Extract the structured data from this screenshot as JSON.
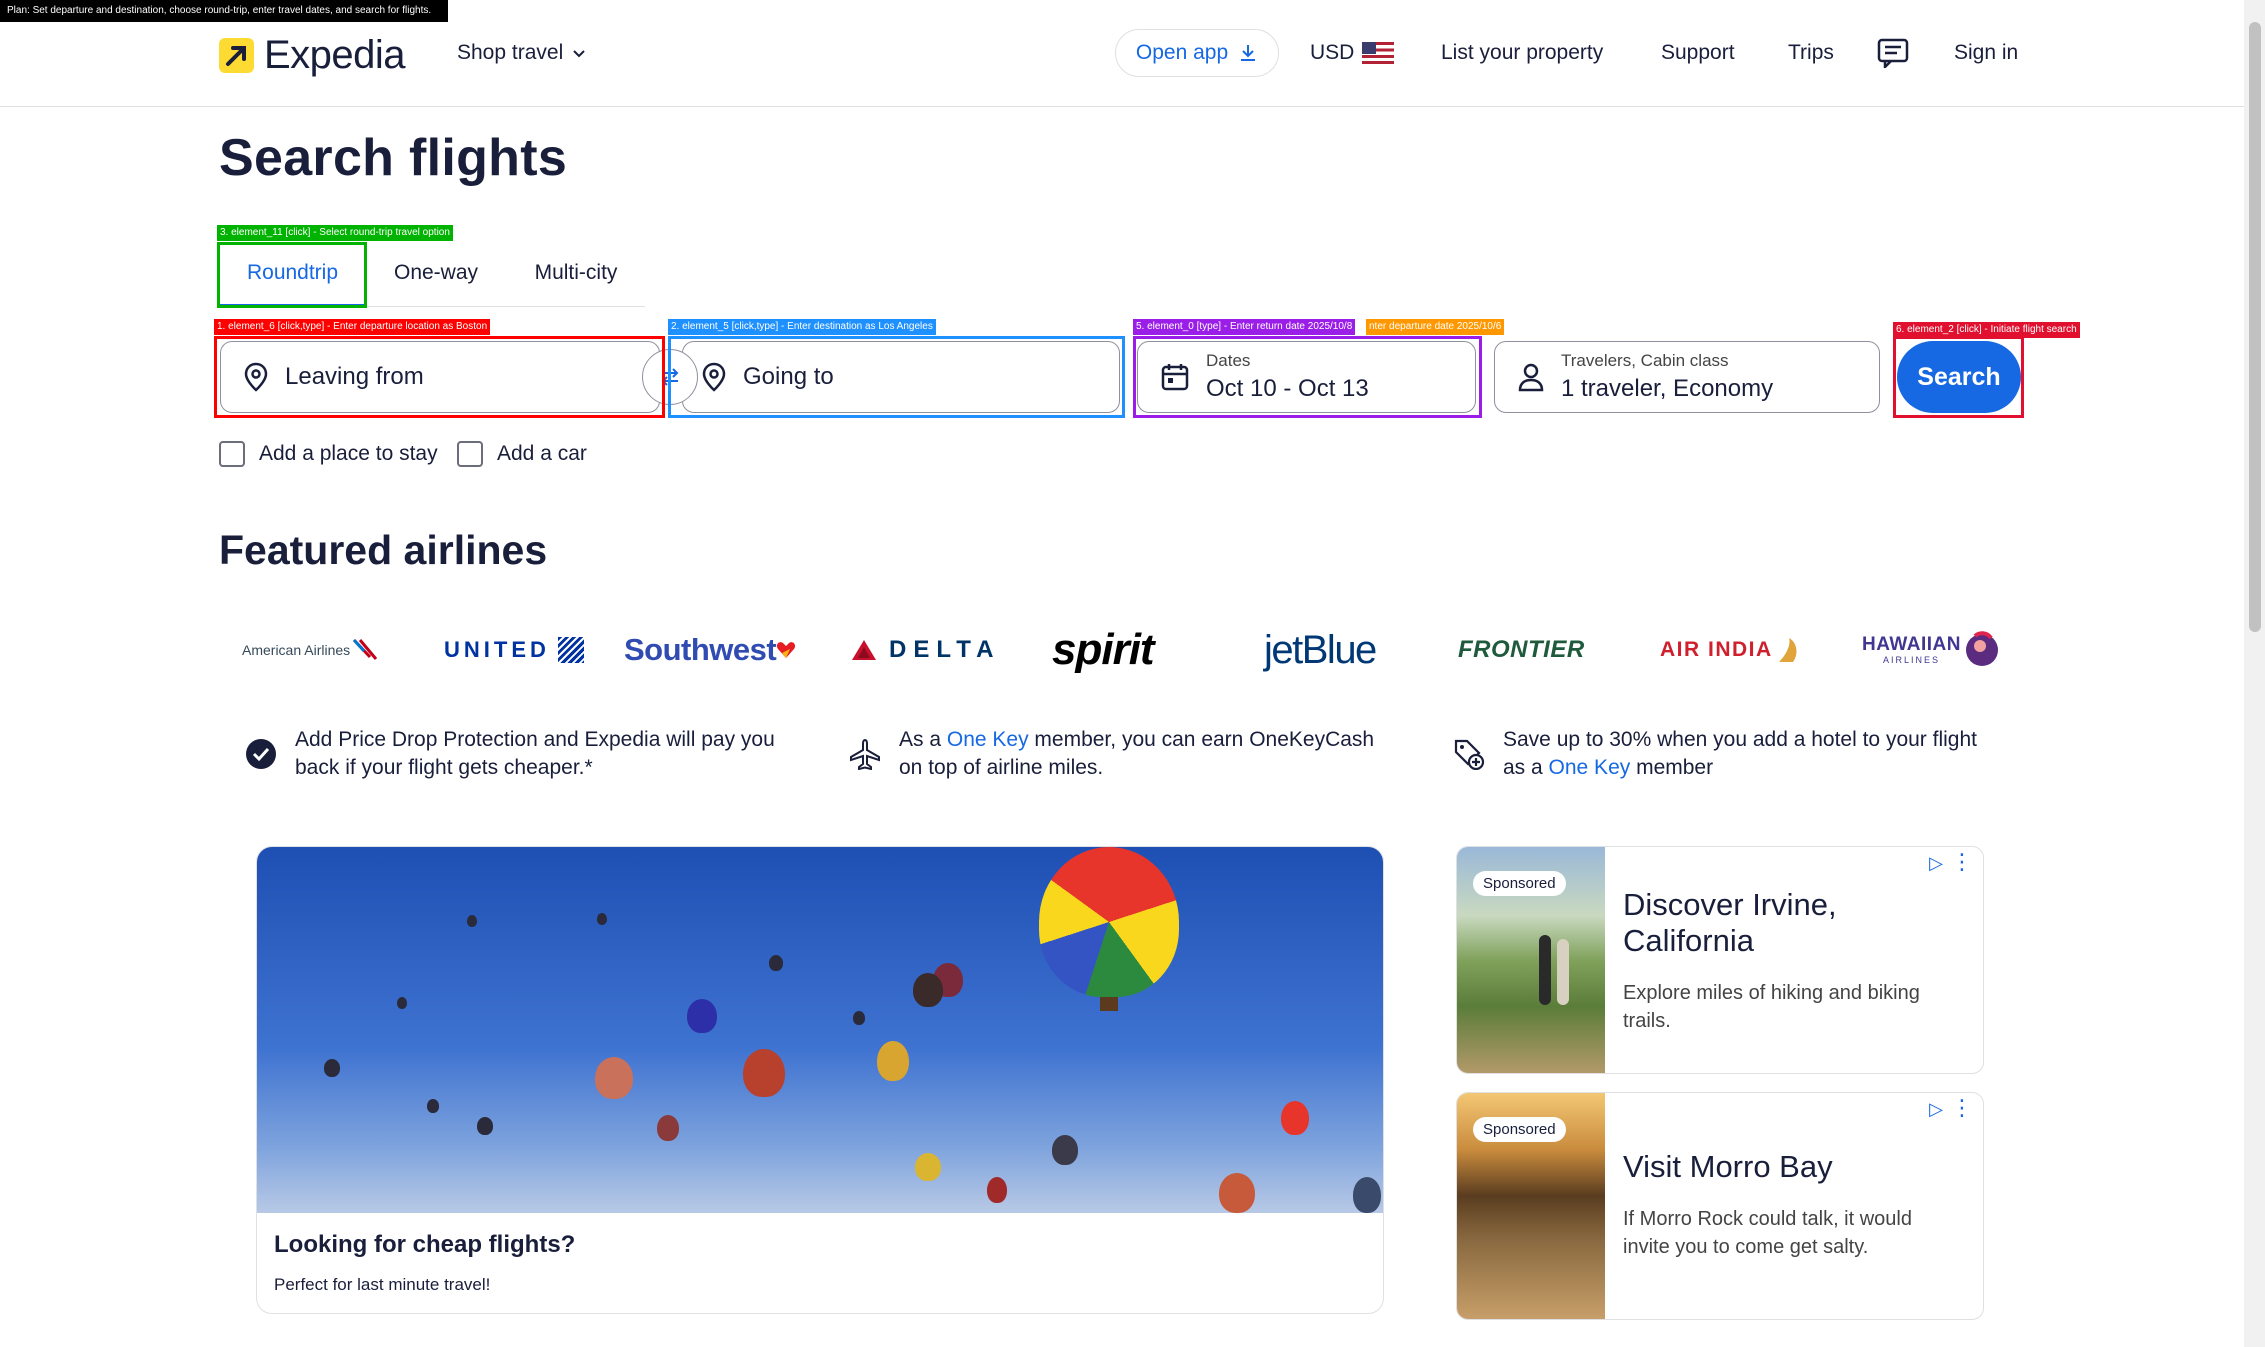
{
  "plan": "Plan: Set departure and destination, choose round-trip, enter travel dates, and search for flights.",
  "header": {
    "logo_text": "Expedia",
    "shop_travel": "Shop travel",
    "open_app": "Open app",
    "currency": "USD",
    "list_property": "List your property",
    "support": "Support",
    "trips": "Trips",
    "sign_in": "Sign in"
  },
  "page_title": "Search flights",
  "tabs": [
    "Roundtrip",
    "One-way",
    "Multi-city"
  ],
  "form": {
    "leaving_from": "Leaving from",
    "going_to": "Going to",
    "dates_label": "Dates",
    "dates_value": "Oct 10 - Oct 13",
    "travelers_label": "Travelers, Cabin class",
    "travelers_value": "1 traveler, Economy",
    "search": "Search",
    "add_stay": "Add a place to stay",
    "add_car": "Add a car"
  },
  "annotations": {
    "roundtrip": "3. element_11 [click] - Select round-trip travel option",
    "leaving": "1. element_6 [click,type] - Enter departure location as Boston",
    "going": "2. element_5 [click,type] - Enter destination as Los Angeles",
    "dates_return": "5. element_0 [type] - Enter return date 2025/10/8",
    "dates_depart": "nter departure date 2025/10/6",
    "search": "6. element_2 [click] - Initiate flight search"
  },
  "featured_title": "Featured airlines",
  "airlines": [
    "American Airlines",
    "UNITED",
    "Southwest",
    "DELTA",
    "spirit",
    "jetBlue",
    "FRONTIER",
    "AIR INDIA",
    "HAWAIIAN",
    "AIRLINES"
  ],
  "benefits": {
    "b1": "Add Price Drop Protection and Expedia will pay you back if your flight gets cheaper.*",
    "b2_pre": "As a ",
    "b2_link": "One Key",
    "b2_post": " member, you can earn OneKeyCash on top of airline miles.",
    "b3_pre": "Save up to 30% when you add a hotel to your flight as a ",
    "b3_link": "One Key",
    "b3_post": " member"
  },
  "promo": {
    "title": "Looking for cheap flights?",
    "subtitle": "Perfect for last minute travel!"
  },
  "ads": [
    {
      "badge": "Sponsored",
      "title_1": "Discover Irvine,",
      "title_2": "California",
      "desc": "Explore miles of hiking and biking trails."
    },
    {
      "badge": "Sponsored",
      "title_1": "Visit Morro Bay",
      "desc": "If Morro Rock could talk, it would invite you to come get salty."
    }
  ],
  "colors": {
    "brand_blue": "#1668e3",
    "logo_yellow": "#fddb32",
    "text": "#191e3b"
  }
}
